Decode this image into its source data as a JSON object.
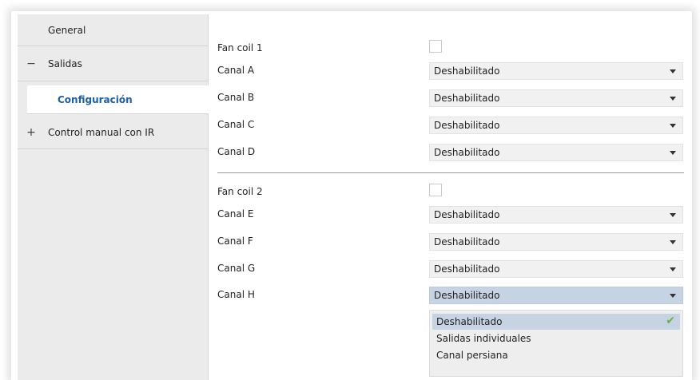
{
  "sidebar": {
    "items": [
      {
        "label": "General",
        "symbol": ""
      },
      {
        "label": "Salidas",
        "symbol": "−"
      },
      {
        "label": "Configuración",
        "symbol": ""
      },
      {
        "label": "Control manual con IR",
        "symbol": "+"
      }
    ]
  },
  "fan_coil_1": {
    "label": "Fan coil 1",
    "checked": false,
    "channels": [
      {
        "label": "Canal A",
        "value": "Deshabilitado"
      },
      {
        "label": "Canal B",
        "value": "Deshabilitado"
      },
      {
        "label": "Canal C",
        "value": "Deshabilitado"
      },
      {
        "label": "Canal D",
        "value": "Deshabilitado"
      }
    ]
  },
  "fan_coil_2": {
    "label": "Fan coil 2",
    "checked": false,
    "channels": [
      {
        "label": "Canal E",
        "value": "Deshabilitado"
      },
      {
        "label": "Canal F",
        "value": "Deshabilitado"
      },
      {
        "label": "Canal G",
        "value": "Deshabilitado"
      },
      {
        "label": "Canal H",
        "value": "Deshabilitado"
      }
    ]
  },
  "dropdown": {
    "options": [
      "Deshabilitado",
      "Salidas individuales",
      "Canal persiana"
    ],
    "selected_index": 0,
    "check_symbol": "✔"
  },
  "colors": {
    "accent": "#1b5fa8",
    "selected_bg": "#c6d3e3",
    "check": "#6ab04c"
  }
}
